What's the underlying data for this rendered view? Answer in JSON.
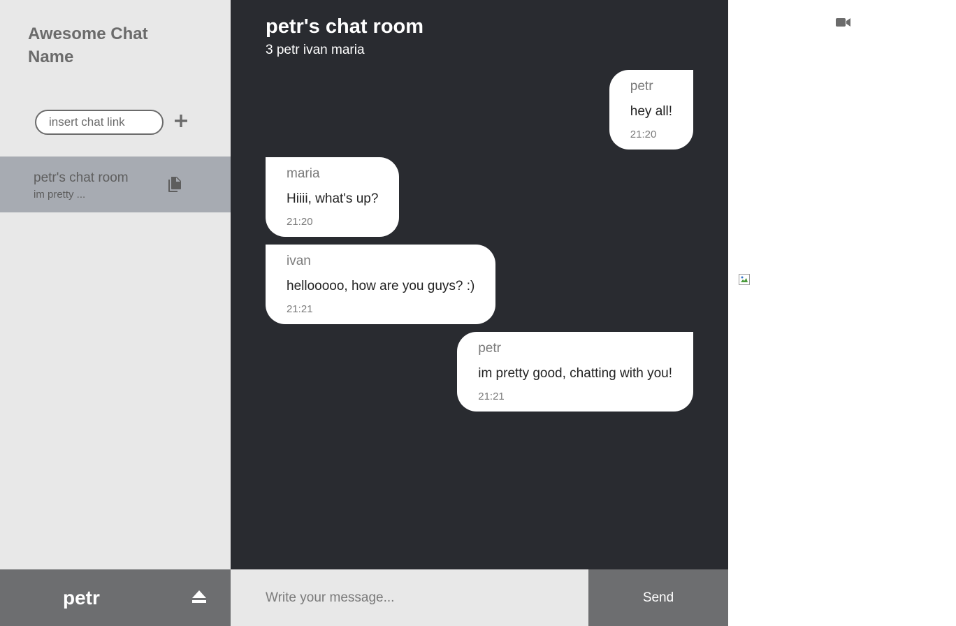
{
  "sidebar": {
    "app_title": "Awesome Chat Name",
    "chat_link_placeholder": "insert chat link",
    "add_icon": "plus-icon",
    "chats": [
      {
        "name": "petr's chat room",
        "preview": "im pretty ...",
        "action_icon": "copy-icon"
      }
    ]
  },
  "user_bar": {
    "username": "petr",
    "logout_icon": "eject-icon"
  },
  "room": {
    "title": "petr's chat room",
    "members": "3 petr ivan maria"
  },
  "messages": [
    {
      "author": "petr",
      "text": "hey all!",
      "time": "21:20",
      "own": true
    },
    {
      "author": "maria",
      "text": "Hiiii, what's up?",
      "time": "21:20",
      "own": false
    },
    {
      "author": "ivan",
      "text": "hellooooo, how are you guys? :)",
      "time": "21:21",
      "own": false
    },
    {
      "author": "petr",
      "text": "im pretty good, chatting with you!",
      "time": "21:21",
      "own": true
    }
  ],
  "composer": {
    "placeholder": "Write your message...",
    "send_label": "Send"
  },
  "video_panel": {
    "video_icon": "video-camera-icon",
    "image_icon": "broken-image-icon"
  },
  "colors": {
    "sidebar_bg": "#e8e8e8",
    "active_chat_bg": "#a7abb2",
    "chat_bg": "#292b30",
    "bubble_bg": "#ffffff",
    "bar_bg": "#6d6e70"
  }
}
